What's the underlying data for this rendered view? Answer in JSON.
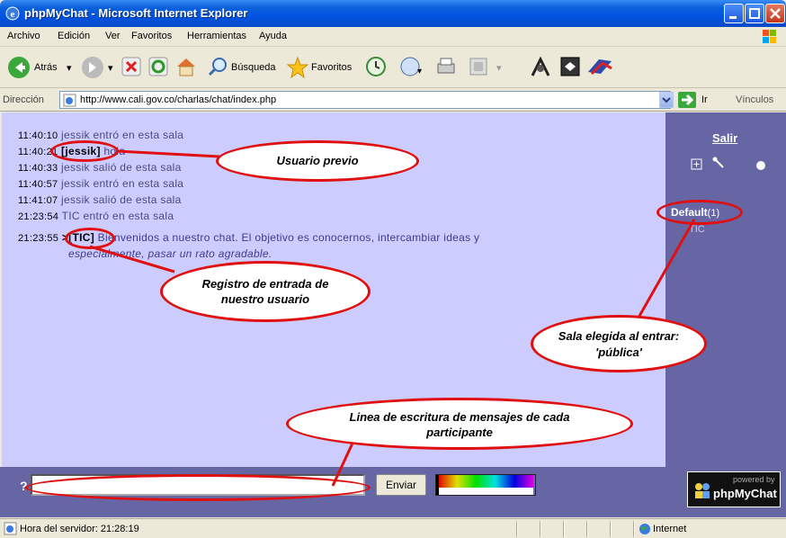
{
  "window": {
    "title": "phpMyChat - Microsoft Internet Explorer"
  },
  "menu": [
    "Archivo",
    "Edición",
    "Ver",
    "Favoritos",
    "Herramientas",
    "Ayuda"
  ],
  "toolbar": {
    "back": "Atrás",
    "search": "Búsqueda",
    "favorites": "Favoritos"
  },
  "address": {
    "label": "Dirección",
    "url": "http://www.cali.gov.co/charlas/chat/index.php",
    "go": "Ir",
    "links": "Vínculos"
  },
  "messages": [
    {
      "time": "11:40:10",
      "user": "",
      "text": "jessik entró en esta sala",
      "type": "system"
    },
    {
      "time": "11:40:21",
      "user": "[jessik]",
      "text": "hola",
      "type": "user"
    },
    {
      "time": "11:40:33",
      "user": "",
      "text": "jessik salió de esta sala",
      "type": "system"
    },
    {
      "time": "11:40:57",
      "user": "",
      "text": "jessik entró en esta sala",
      "type": "system"
    },
    {
      "time": "11:41:07",
      "user": "",
      "text": "jessik salió de esta sala",
      "type": "system"
    },
    {
      "time": "21:23:54",
      "user": "",
      "text": "TIC entró en esta sala",
      "type": "system"
    },
    {
      "time": "21:23:55",
      "user": ">[TIC]",
      "text": "Bienvenidos a nuestro chat. El objetivo es conocernos, intercambiar ideas y",
      "text2": "especialmente, pasar un rato agradable.",
      "type": "user"
    }
  ],
  "sidebar": {
    "exit": "Salir",
    "room": "Default",
    "room_count": "(1)",
    "room_user": "TIC"
  },
  "input": {
    "help": "?",
    "value": "",
    "send": "Enviar"
  },
  "logo": {
    "small": "powered by",
    "big": "phpMyChat"
  },
  "callouts": {
    "prev_user": "Usuario previo",
    "entry_log": "Registro de entrada de nuestro usuario",
    "room": "Sala elegida al entrar: 'pública'",
    "input_line": "Linea de escritura de mensajes de cada participante"
  },
  "status": {
    "text": "Hora del servidor: 21:28:19",
    "zone": "Internet"
  },
  "colors": {
    "chat_bg": "#ccccff",
    "panel_bg": "#6666a5",
    "callout_border": "#e01010",
    "titlebar": "#0054e3"
  }
}
